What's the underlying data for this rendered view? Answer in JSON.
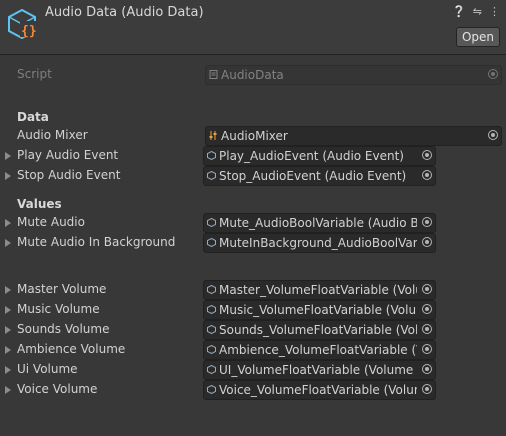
{
  "header": {
    "title": "Audio Data (Audio Data)",
    "open_label": "Open",
    "icons": [
      "help-icon",
      "preset-icon",
      "more-icon"
    ]
  },
  "script": {
    "label": "Script",
    "value": "AudioData"
  },
  "sections": {
    "data": "Data",
    "values": "Values"
  },
  "fields": {
    "audio_mixer": {
      "label": "Audio Mixer",
      "value": "AudioMixer"
    },
    "play_audio_event": {
      "label": "Play Audio Event",
      "value": "Play_AudioEvent (Audio Event)"
    },
    "stop_audio_event": {
      "label": "Stop Audio Event",
      "value": "Stop_AudioEvent (Audio Event)"
    },
    "mute_audio": {
      "label": "Mute Audio",
      "value": "Mute_AudioBoolVariable (Audio Boo"
    },
    "mute_audio_in_background": {
      "label": "Mute Audio In Background",
      "value": "MuteInBackground_AudioBoolVaria"
    },
    "master_volume": {
      "label": "Master Volume",
      "value": "Master_VolumeFloatVariable (Volum"
    },
    "music_volume": {
      "label": "Music Volume",
      "value": "Music_VolumeFloatVariable (Volum"
    },
    "sounds_volume": {
      "label": "Sounds Volume",
      "value": "Sounds_VolumeFloatVariable (Volu"
    },
    "ambience_volume": {
      "label": "Ambience Volume",
      "value": "Ambience_VolumeFloatVariable (Vo"
    },
    "ui_volume": {
      "label": "Ui Volume",
      "value": "UI_VolumeFloatVariable (Volume Fl"
    },
    "voice_volume": {
      "label": "Voice Volume",
      "value": "Voice_VolumeFloatVariable (Volum"
    }
  },
  "colors": {
    "background": "#383838",
    "field": "#2a2a2a",
    "text": "#d2d2d2",
    "asset_icon": "#5fc3f0",
    "asset_braces": "#f08a3c",
    "mixer_icon": "#e8a33a"
  }
}
